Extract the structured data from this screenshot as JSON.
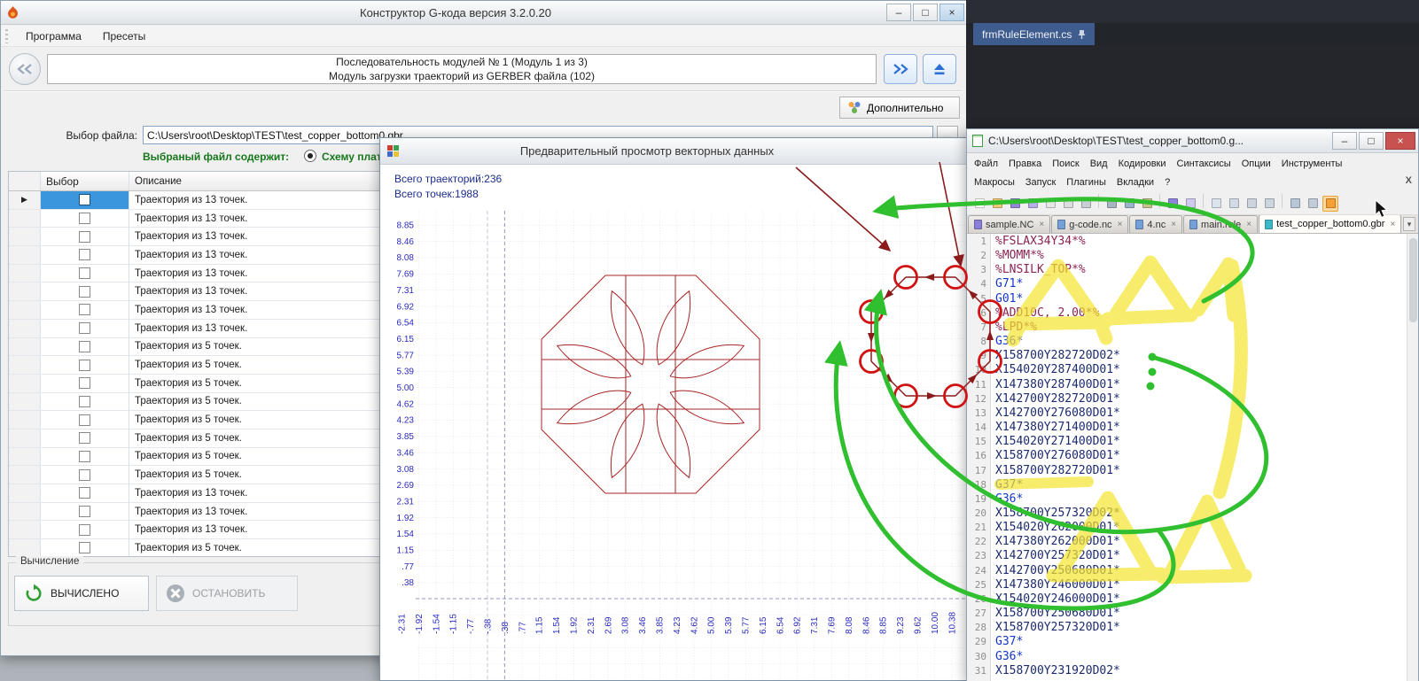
{
  "main_window": {
    "title": "Конструктор G-кода версия 3.2.0.20",
    "window_buttons": {
      "minimize": "–",
      "maximize": "□",
      "close": "×"
    },
    "menu_items": [
      "Программа",
      "Пресеты"
    ],
    "sequence_bar": {
      "line1": "Последовательность модулей № 1 (Модуль 1 из 3)",
      "line2": "Модуль загрузки траекторий из GERBER файла (102)"
    },
    "additional_button_label": "Дополнительно",
    "file_section": {
      "label": "Выбор файла:",
      "path": "C:\\Users\\root\\Desktop\\TEST\\test_copper_bottom0.gbr",
      "browse_label": "...",
      "contains_label": "Выбраный файл содержит:",
      "contains_option": "Схему платы"
    },
    "table": {
      "selector_glyph": "▶",
      "columns": [
        "Выбор",
        "Описание"
      ],
      "rows": [
        "Траектория из 13 точек.",
        "Траектория из 13 точек.",
        "Траектория из 13 точек.",
        "Траектория из 13 точек.",
        "Траектория из 13 точек.",
        "Траектория из 13 точек.",
        "Траектория из 13 точек.",
        "Траектория из 13 точек.",
        "Траектория из 5 точек.",
        "Траектория из 5 точек.",
        "Траектория из 5 точек.",
        "Траектория из 5 точек.",
        "Траектория из 5 точек.",
        "Траектория из 5 точек.",
        "Траектория из 5 точек.",
        "Траектория из 5 точек.",
        "Траектория из 13 точек.",
        "Траектория из 13 точек.",
        "Траектория из 13 точек.",
        "Траектория из 5 точек."
      ]
    },
    "compute": {
      "group_title": "Вычисление",
      "computed_label": "ВЫЧИСЛЕНО",
      "stop_label": "ОСТАНОВИТЬ"
    }
  },
  "preview_window": {
    "title": "Предварительный просмотр векторных данных",
    "stats_line1": "Всего траекторий:236",
    "stats_line2": "Всего точек:1988",
    "pattern_color": "#a82424",
    "y_axis_labels": [
      "8.85",
      "8.46",
      "8.08",
      "7.69",
      "7.31",
      "6.92",
      "6.54",
      "6.15",
      "5.77",
      "5.39",
      "5.00",
      "4.62",
      "4.23",
      "3.85",
      "3.46",
      "3.08",
      "2.69",
      "2.31",
      "1.92",
      "1.54",
      "1.15",
      ".77",
      ".38"
    ],
    "x_axis_labels": [
      "-2.31",
      "-1.92",
      "-1.54",
      "-1.15",
      "-.77",
      "-.38",
      ".38",
      ".77",
      "1.15",
      "1.54",
      "1.92",
      "2.31",
      "2.69",
      "3.08",
      "3.46",
      "3.85",
      "4.23",
      "4.62",
      "5.00",
      "5.39",
      "5.77",
      "6.15",
      "6.54",
      "6.92",
      "7.31",
      "7.69",
      "8.08",
      "8.46",
      "8.85",
      "9.23",
      "9.62",
      "10.00",
      "10.38"
    ]
  },
  "vs_panel": {
    "tab_label": "frmRuleElement.cs"
  },
  "npp_window": {
    "title": "C:\\Users\\root\\Desktop\\TEST\\test_copper_bottom0.g...",
    "window_buttons": {
      "minimize": "–",
      "maximize": "□",
      "close": "×"
    },
    "menu_row1": [
      "Файл",
      "Правка",
      "Поиск",
      "Вид",
      "Кодировки",
      "Синтаксисы",
      "Опции",
      "Инструменты"
    ],
    "menu_row2": [
      "Макросы",
      "Запуск",
      "Плагины",
      "Вкладки",
      "?"
    ],
    "menu_close_glyph": "X",
    "tab_list_glyph": "▾",
    "tab_close_glyph": "×",
    "toolbar_icons": [
      {
        "name": "new-file",
        "color": "#ffffff"
      },
      {
        "name": "open-file",
        "color": "#f3c878"
      },
      {
        "name": "save",
        "color": "#9488d8"
      },
      {
        "name": "save-all",
        "color": "#b7aee6"
      },
      {
        "name": "close-doc",
        "color": "#e7e7e7"
      },
      {
        "name": "close-all-docs",
        "color": "#dddddd"
      },
      {
        "name": "print",
        "color": "#c9ced5"
      },
      {
        "sep": true
      },
      {
        "name": "cut",
        "color": "#a9b5c3"
      },
      {
        "name": "copy",
        "color": "#9db3cb"
      },
      {
        "name": "paste",
        "color": "#c9c28b"
      },
      {
        "sep": true
      },
      {
        "name": "undo",
        "color": "#8f83dd"
      },
      {
        "name": "redo",
        "color": "#cfc9f0"
      },
      {
        "sep": true
      },
      {
        "name": "find",
        "color": "#dbe3ec"
      },
      {
        "name": "replace",
        "color": "#d2dae4"
      },
      {
        "name": "zoom-in",
        "color": "#ccd5de"
      },
      {
        "name": "zoom-out",
        "color": "#ccd5de"
      },
      {
        "sep": true
      },
      {
        "name": "word-wrap",
        "color": "#b7c5d6"
      },
      {
        "name": "show-all-characters",
        "color": "#c2ccd8"
      },
      {
        "name": "document-monitor",
        "color": "#f59f35",
        "highlight": true
      }
    ],
    "tabs": [
      {
        "label": "sample.NC",
        "icon_color": "#8a7fd6"
      },
      {
        "label": "g-code.nc",
        "icon_color": "#74a0d8"
      },
      {
        "label": "4.nc",
        "icon_color": "#74a0d8"
      },
      {
        "label": "main.rule",
        "icon_color": "#74a0d8"
      },
      {
        "label": "test_copper_bottom0.gbr",
        "icon_color": "#3cb8c9",
        "active": true
      }
    ],
    "code_lines": [
      {
        "n": 1,
        "t": "%FSLAX34Y34*%",
        "k": "p"
      },
      {
        "n": 2,
        "t": "%MOMM*%",
        "k": "p"
      },
      {
        "n": 3,
        "t": "%LNSILK_TOP*%",
        "k": "p"
      },
      {
        "n": 4,
        "t": "G71*",
        "k": "g"
      },
      {
        "n": 5,
        "t": "G01*",
        "k": "g"
      },
      {
        "n": 6,
        "t": "%ADD10C, 2.00*%",
        "k": "p"
      },
      {
        "n": 7,
        "t": "%LPD*%",
        "k": "p"
      },
      {
        "n": 8,
        "t": "G36*",
        "k": "g"
      },
      {
        "n": 9,
        "t": "X158700Y282720D02*",
        "k": "c"
      },
      {
        "n": 10,
        "t": "X154020Y287400D01*",
        "k": "c"
      },
      {
        "n": 11,
        "t": "X147380Y287400D01*",
        "k": "c"
      },
      {
        "n": 12,
        "t": "X142700Y282720D01*",
        "k": "c"
      },
      {
        "n": 13,
        "t": "X142700Y276080D01*",
        "k": "c"
      },
      {
        "n": 14,
        "t": "X147380Y271400D01*",
        "k": "c"
      },
      {
        "n": 15,
        "t": "X154020Y271400D01*",
        "k": "c"
      },
      {
        "n": 16,
        "t": "X158700Y276080D01*",
        "k": "c"
      },
      {
        "n": 17,
        "t": "X158700Y282720D01*",
        "k": "c"
      },
      {
        "n": 18,
        "t": "G37*",
        "k": "g"
      },
      {
        "n": 19,
        "t": "G36*",
        "k": "g"
      },
      {
        "n": 20,
        "t": "X158700Y257320D02*",
        "k": "c"
      },
      {
        "n": 21,
        "t": "X154020Y262000D01*",
        "k": "c"
      },
      {
        "n": 22,
        "t": "X147380Y262000D01*",
        "k": "c"
      },
      {
        "n": 23,
        "t": "X142700Y257320D01*",
        "k": "c"
      },
      {
        "n": 24,
        "t": "X142700Y250680D01*",
        "k": "c"
      },
      {
        "n": 25,
        "t": "X147380Y246000D01*",
        "k": "c"
      },
      {
        "n": 26,
        "t": "X154020Y246000D01*",
        "k": "c"
      },
      {
        "n": 27,
        "t": "X158700Y250680D01*",
        "k": "c"
      },
      {
        "n": 28,
        "t": "X158700Y257320D01*",
        "k": "c"
      },
      {
        "n": 29,
        "t": "G37*",
        "k": "g"
      },
      {
        "n": 30,
        "t": "G36*",
        "k": "g"
      },
      {
        "n": 31,
        "t": "X158700Y231920D02*",
        "k": "c"
      }
    ]
  },
  "annotations": {
    "accent_green": "#2fbf2f",
    "accent_red": "#d01212",
    "accent_darkred": "#8b1a1a",
    "marker_yellow": "#f5e42e"
  }
}
